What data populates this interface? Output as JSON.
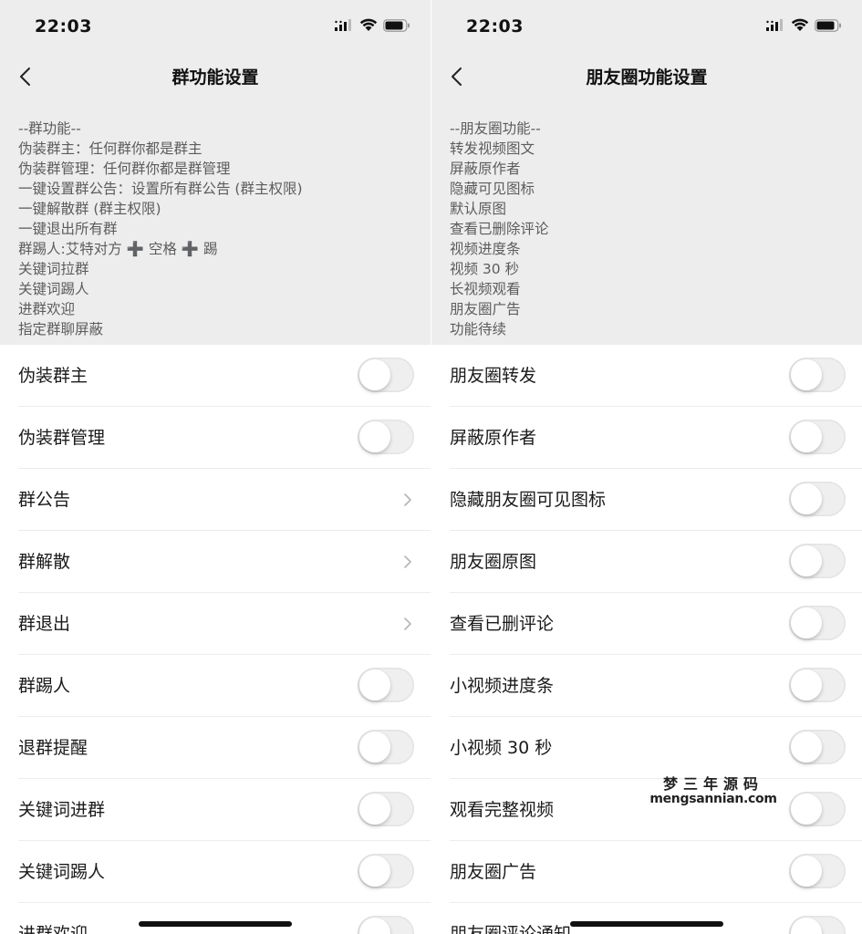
{
  "left": {
    "time": "22:03",
    "title": "群功能设置",
    "desc_lines": [
      "--群功能--",
      "伪装群主：任何群你都是群主",
      "伪装群管理：任何群你都是群管理",
      "一键设置群公告：设置所有群公告 (群主权限)",
      "一键解散群 (群主权限)",
      "一键退出所有群",
      "群踢人:艾特对方 ➕ 空格 ➕ 踢",
      "关键词拉群",
      "关键词踢人",
      "进群欢迎",
      "指定群聊屏蔽"
    ],
    "rows": [
      {
        "label": "伪装群主",
        "control": "toggle",
        "state": "off"
      },
      {
        "label": "伪装群管理",
        "control": "toggle",
        "state": "off"
      },
      {
        "label": "群公告",
        "control": "chevron"
      },
      {
        "label": "群解散",
        "control": "chevron"
      },
      {
        "label": "群退出",
        "control": "chevron"
      },
      {
        "label": "群踢人",
        "control": "toggle",
        "state": "off"
      },
      {
        "label": "退群提醒",
        "control": "toggle",
        "state": "off"
      },
      {
        "label": "关键词进群",
        "control": "toggle",
        "state": "off"
      },
      {
        "label": "关键词踢人",
        "control": "toggle",
        "state": "off"
      },
      {
        "label": "进群欢迎",
        "control": "toggle",
        "state": "off"
      }
    ]
  },
  "right": {
    "time": "22:03",
    "title": "朋友圈功能设置",
    "desc_lines": [
      "--朋友圈功能--",
      "转发视频图文",
      "屏蔽原作者",
      "隐藏可见图标",
      "默认原图",
      "查看已删除评论",
      "视频进度条",
      "视频 30 秒",
      "长视频观看",
      "朋友圈广告",
      "功能待续"
    ],
    "rows": [
      {
        "label": "朋友圈转发",
        "control": "toggle",
        "state": "off"
      },
      {
        "label": "屏蔽原作者",
        "control": "toggle",
        "state": "off"
      },
      {
        "label": "隐藏朋友圈可见图标",
        "control": "toggle",
        "state": "off"
      },
      {
        "label": "朋友圈原图",
        "control": "toggle",
        "state": "off"
      },
      {
        "label": "查看已删评论",
        "control": "toggle",
        "state": "off"
      },
      {
        "label": "小视频进度条",
        "control": "toggle",
        "state": "off"
      },
      {
        "label": "小视频 30 秒",
        "control": "toggle",
        "state": "off"
      },
      {
        "label": "观看完整视频",
        "control": "toggle",
        "state": "off"
      },
      {
        "label": "朋友圈广告",
        "control": "toggle",
        "state": "off"
      },
      {
        "label": "朋友圈评论通知",
        "control": "toggle",
        "state": "off"
      }
    ]
  },
  "watermark": {
    "cn": "梦三年源码",
    "en": "mengsannian.com"
  }
}
